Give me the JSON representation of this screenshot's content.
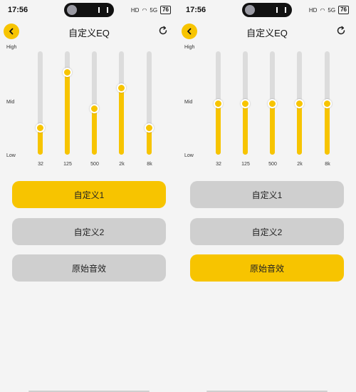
{
  "colors": {
    "accent": "#f7c400",
    "track": "#dcdcdc",
    "inactive_button": "#cfcfcf"
  },
  "screens": [
    {
      "status": {
        "time": "17:56",
        "hd": "HD",
        "signal": "5G",
        "battery": "76"
      },
      "title": "自定义EQ",
      "levels": {
        "high": "High",
        "mid": "Mid",
        "low": "Low"
      },
      "bands": [
        {
          "freq": "32",
          "level": 0.26
        },
        {
          "freq": "125",
          "level": 0.8
        },
        {
          "freq": "500",
          "level": 0.45
        },
        {
          "freq": "2k",
          "level": 0.65
        },
        {
          "freq": "8k",
          "level": 0.26
        }
      ],
      "presets": [
        {
          "label": "自定义1",
          "active": true
        },
        {
          "label": "自定义2",
          "active": false
        },
        {
          "label": "原始音效",
          "active": false
        }
      ]
    },
    {
      "status": {
        "time": "17:56",
        "hd": "HD",
        "signal": "5G",
        "battery": "76"
      },
      "title": "自定义EQ",
      "levels": {
        "high": "High",
        "mid": "Mid",
        "low": "Low"
      },
      "bands": [
        {
          "freq": "32",
          "level": 0.5
        },
        {
          "freq": "125",
          "level": 0.5
        },
        {
          "freq": "500",
          "level": 0.5
        },
        {
          "freq": "2k",
          "level": 0.5
        },
        {
          "freq": "8k",
          "level": 0.5
        }
      ],
      "presets": [
        {
          "label": "自定义1",
          "active": false
        },
        {
          "label": "自定义2",
          "active": false
        },
        {
          "label": "原始音效",
          "active": true
        }
      ]
    }
  ]
}
